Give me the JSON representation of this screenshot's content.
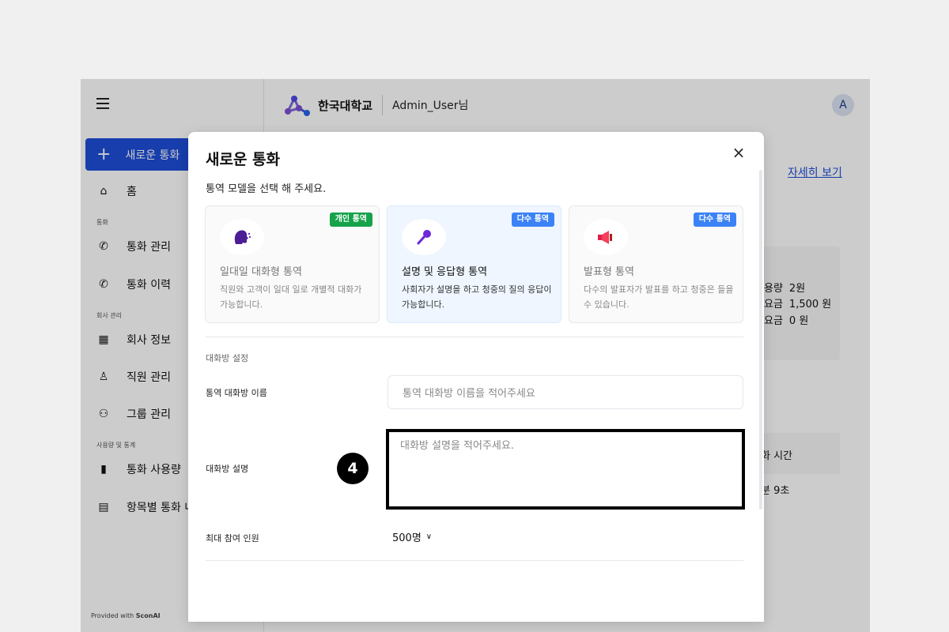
{
  "header": {
    "brand": "한국대학교",
    "user": "Admin_User님",
    "avatar_initial": "A"
  },
  "sidebar": {
    "new_call": "새로운 통화",
    "home": "홈",
    "section_call": "통화",
    "call_manage": "통화 관리",
    "call_history": "통화 이력",
    "section_company": "회사 관리",
    "company_info": "회사 정보",
    "staff_manage": "직원 관리",
    "group_manage": "그룹 관리",
    "section_usage": "사용량 및 통계",
    "call_usage": "통화 사용량",
    "item_call": "항목별 통화 내",
    "provided_prefix": "Provided with ",
    "provided_brand": "SconAI"
  },
  "background": {
    "detail_link": "자세히 보기",
    "stats": [
      {
        "label": "용량",
        "value": "2원"
      },
      {
        "label": "요금",
        "value": "1,500 원"
      },
      {
        "label": "요금",
        "value": "0 원"
      }
    ],
    "table_header": "화 시간",
    "table_value": "분 9초"
  },
  "modal": {
    "title": "새로운 통화",
    "close": "×",
    "subtitle": "통역 모델을 선택 해 주세요.",
    "models": [
      {
        "badge": "개인 통역",
        "badge_color": "#16a34a",
        "title": "일대일 대화형 통역",
        "desc": "직원와 고객이 일대 일로 개별적 대화가 가능합니다.",
        "icon": "speaking-head-icon"
      },
      {
        "badge": "다수 통역",
        "badge_color": "#3b82f6",
        "title": "설명 및 응답형 통역",
        "desc": "사회자가 설명을 하고 청중의 질의 응답이 가능합니다.",
        "icon": "microphone-icon"
      },
      {
        "badge": "다수 통역",
        "badge_color": "#3b82f6",
        "title": "발표형 통역",
        "desc": "다수의 발표자가 발표를 하고 청중은 들을 수 있습니다.",
        "icon": "megaphone-icon"
      }
    ],
    "room_section": "대화방 설정",
    "room_name_label": "통역 대화방 이름",
    "room_name_placeholder": "통역 대화방 이름을 적어주세요",
    "room_desc_label": "대화방 설명",
    "room_desc_placeholder": "대화방 설명을 적어주세요.",
    "step_number": "4",
    "max_label": "최대 참여 인원",
    "max_value": "500명"
  },
  "colors": {
    "primary": "#1d4ed8",
    "badge_green": "#16a34a",
    "badge_blue": "#3b82f6"
  }
}
